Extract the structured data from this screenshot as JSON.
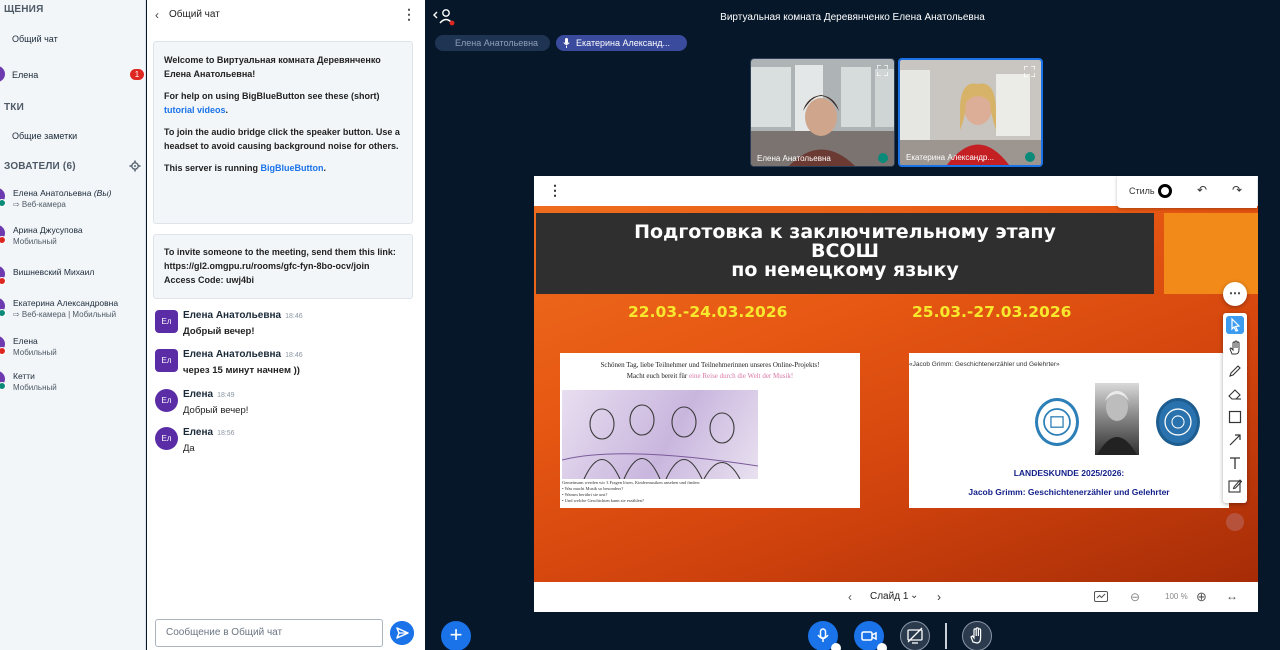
{
  "sidebar": {
    "messages_header": "ЩЕНИЯ",
    "public_chat": "Общий чат",
    "private_chat_user": "Елена",
    "private_unread": "1",
    "notes_header": "ТКИ",
    "shared_notes": "Общие заметки",
    "users_header": "ЗОВАТЕЛИ (6)",
    "users": [
      {
        "name": "Елена Анатольевна",
        "you_tag": "(Вы)",
        "status": "⇨ Веб-камера"
      },
      {
        "name": "Арина Джусупова",
        "status": "Мобильный"
      },
      {
        "name": "Вишневский Михаил",
        "status": ""
      },
      {
        "name": "Екатерина Александровна",
        "status": "⇨ Веб-камера | Мобильный"
      },
      {
        "name": "Елена",
        "status": "Мобильный"
      },
      {
        "name": "Кетти",
        "status": "Мобильный"
      }
    ]
  },
  "chat": {
    "title": "Общий чат",
    "welcome": {
      "line1_pre": "Welcome to ",
      "room_name": "Виртуальная комната Деревянченко Елена Анатольевна",
      "line1_post": "!",
      "help_pre": "For help on using BigBlueButton see these (short) ",
      "help_link": "tutorial videos",
      "help_post": ".",
      "audio": "To join the audio bridge click the speaker button. Use a headset to avoid causing background noise for others.",
      "server_pre": "This server is running ",
      "server_link": "BigBlueButton",
      "server_post": "."
    },
    "invite": {
      "line1": "To invite someone to the meeting, send them this link:",
      "link": "https://gl2.omgpu.ru/rooms/gfc-fyn-8bo-ocv/join",
      "code": "Access Code: uwj4bi"
    },
    "messages": [
      {
        "avatar": "Ел",
        "name": "Елена Анатольевна",
        "time": "18:46",
        "text": "Добрый вечер!"
      },
      {
        "avatar": "Ел",
        "name": "Елена Анатольевна",
        "time": "18:46",
        "text": "через 15 минут начнем ))"
      },
      {
        "avatar": "Ел",
        "name": "Елена",
        "time": "18:49",
        "text": "Добрый вечер!"
      },
      {
        "avatar": "Ел",
        "name": "Елена",
        "time": "18:56",
        "text": "Да"
      }
    ],
    "input_placeholder": "Сообщение в Общий чат"
  },
  "main": {
    "room_title": "Виртуальная комната Деревянченко Елена Анатольевна",
    "talkers": [
      "Елена Анатольевна",
      "Екатерина Александ..."
    ],
    "videos": [
      {
        "name": "Елена Анатольевна"
      },
      {
        "name": "Екатерина Александр..."
      }
    ],
    "toolbar_style": "Стиль",
    "slide": {
      "title_lines": [
        "Подготовка к заключительному этапу",
        "ВСОШ",
        "по немецкому языку"
      ],
      "date1": "22.03.-24.03.2026",
      "date2": "25.03.-27.03.2026",
      "card1_line1": "Schönen Tag, liebe Teilnehmer und Teilnehmerinnen unseres Online-Projekts!",
      "card1_line2_pre": "Macht euch bereit für ",
      "card1_line2_pink": "eine Reise durch die Welt der Musik!",
      "card1_note": "Gemeinsam werden wir 3 Fragen lösen, Kindermusiken ansehen und finden:",
      "card1_bullets": [
        "Was macht Musik so besonders?",
        "Warum berührt sie uns?",
        "Und welche Geschichten kann sie erzählen?"
      ],
      "card2_top": "«Jacob Grimm: Geschichtenerzähler und Gelehrter»",
      "card2_label1": "LANDESKUNDE 2025/2026:",
      "card2_label2": "Jacob Grimm: Geschichtenerzähler und Gelehrter"
    },
    "slide_number": "Слайд 1",
    "zoom": "100 %"
  }
}
